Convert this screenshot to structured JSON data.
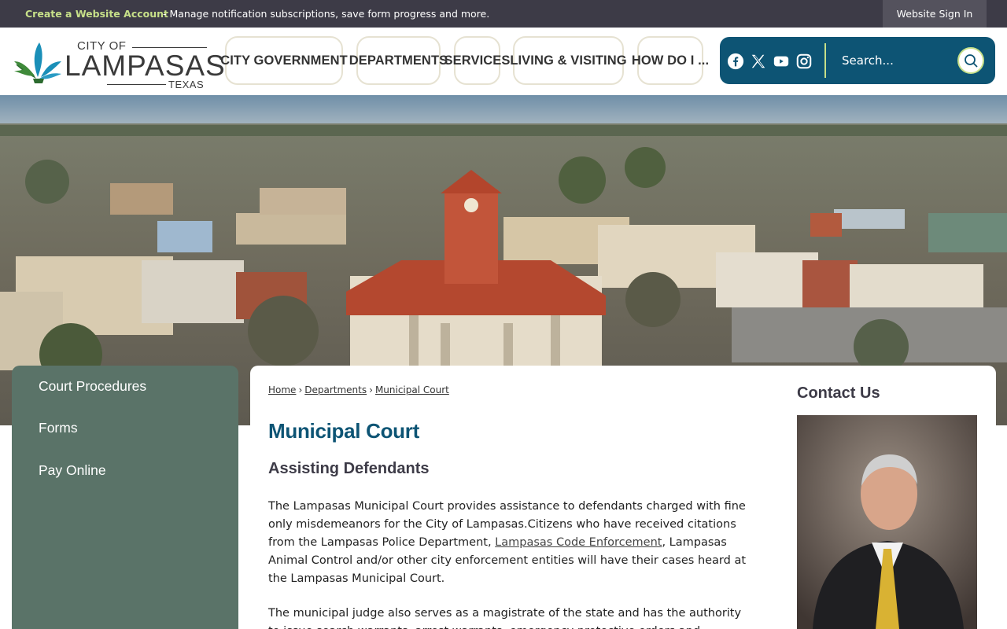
{
  "topbar": {
    "create_account": "Create a Website Account",
    "message": "- Manage notification subscriptions, save form progress and more.",
    "sign_in": "Website Sign In"
  },
  "logo": {
    "city_of": "CITY OF",
    "name": "LAMPASAS",
    "state": "TEXAS"
  },
  "nav": {
    "items": [
      {
        "label": "CITY GOVERNMENT"
      },
      {
        "label": "DEPARTMENTS"
      },
      {
        "label": "SERVICES"
      },
      {
        "label": "LIVING & VISITING"
      },
      {
        "label": "HOW DO I ..."
      }
    ]
  },
  "social": [
    "facebook-icon",
    "x-twitter-icon",
    "youtube-icon",
    "instagram-icon"
  ],
  "search": {
    "placeholder": "Search..."
  },
  "sidenav": {
    "items": [
      {
        "label": "Court Procedures"
      },
      {
        "label": "Forms"
      },
      {
        "label": "Pay Online"
      }
    ]
  },
  "breadcrumb": {
    "items": [
      "Home",
      "Departments",
      "Municipal Court"
    ],
    "separator": "›"
  },
  "main": {
    "title": "Municipal Court",
    "subheading": "Assisting Defendants",
    "para1_before": "The Lampasas Municipal Court provides assistance to defendants charged with fine only misdemeanors for the City of Lampasas.Citizens who have received citations from the Lampasas Police Department, ",
    "para1_link": "Lampasas Code Enforcement",
    "para1_after": ", Lampasas Animal Control and/or other city enforcement entities will have their cases heard at the Lampasas Municipal Court.",
    "para2": "The municipal judge also serves as a magistrate of the state and has the authority to issue search warrants, arrest warrants, emergency protective orders and"
  },
  "contact": {
    "title": "Contact Us"
  },
  "colors": {
    "topbar": "#3d3b47",
    "accent_green": "#c7e089",
    "brand_blue": "#0d5474",
    "sidenav": "#5a7368"
  }
}
